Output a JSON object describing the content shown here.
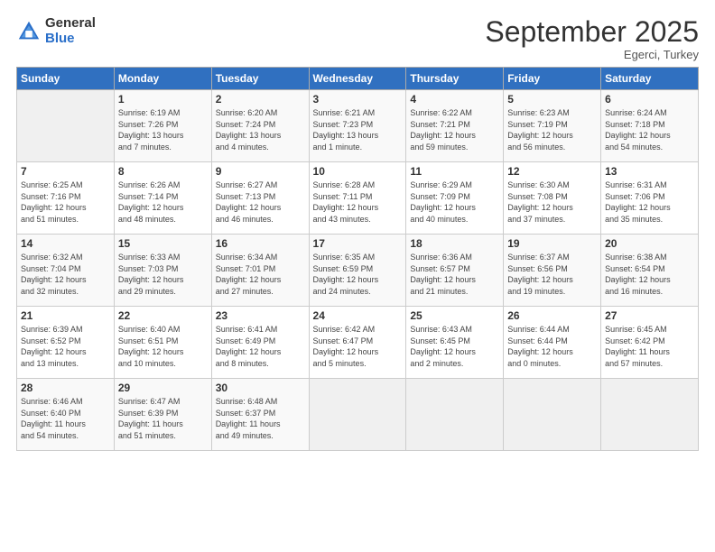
{
  "logo": {
    "general": "General",
    "blue": "Blue"
  },
  "header": {
    "month": "September 2025",
    "location": "Egerci, Turkey"
  },
  "days_of_week": [
    "Sunday",
    "Monday",
    "Tuesday",
    "Wednesday",
    "Thursday",
    "Friday",
    "Saturday"
  ],
  "weeks": [
    [
      {
        "day": "",
        "info": ""
      },
      {
        "day": "1",
        "info": "Sunrise: 6:19 AM\nSunset: 7:26 PM\nDaylight: 13 hours\nand 7 minutes."
      },
      {
        "day": "2",
        "info": "Sunrise: 6:20 AM\nSunset: 7:24 PM\nDaylight: 13 hours\nand 4 minutes."
      },
      {
        "day": "3",
        "info": "Sunrise: 6:21 AM\nSunset: 7:23 PM\nDaylight: 13 hours\nand 1 minute."
      },
      {
        "day": "4",
        "info": "Sunrise: 6:22 AM\nSunset: 7:21 PM\nDaylight: 12 hours\nand 59 minutes."
      },
      {
        "day": "5",
        "info": "Sunrise: 6:23 AM\nSunset: 7:19 PM\nDaylight: 12 hours\nand 56 minutes."
      },
      {
        "day": "6",
        "info": "Sunrise: 6:24 AM\nSunset: 7:18 PM\nDaylight: 12 hours\nand 54 minutes."
      }
    ],
    [
      {
        "day": "7",
        "info": "Sunrise: 6:25 AM\nSunset: 7:16 PM\nDaylight: 12 hours\nand 51 minutes."
      },
      {
        "day": "8",
        "info": "Sunrise: 6:26 AM\nSunset: 7:14 PM\nDaylight: 12 hours\nand 48 minutes."
      },
      {
        "day": "9",
        "info": "Sunrise: 6:27 AM\nSunset: 7:13 PM\nDaylight: 12 hours\nand 46 minutes."
      },
      {
        "day": "10",
        "info": "Sunrise: 6:28 AM\nSunset: 7:11 PM\nDaylight: 12 hours\nand 43 minutes."
      },
      {
        "day": "11",
        "info": "Sunrise: 6:29 AM\nSunset: 7:09 PM\nDaylight: 12 hours\nand 40 minutes."
      },
      {
        "day": "12",
        "info": "Sunrise: 6:30 AM\nSunset: 7:08 PM\nDaylight: 12 hours\nand 37 minutes."
      },
      {
        "day": "13",
        "info": "Sunrise: 6:31 AM\nSunset: 7:06 PM\nDaylight: 12 hours\nand 35 minutes."
      }
    ],
    [
      {
        "day": "14",
        "info": "Sunrise: 6:32 AM\nSunset: 7:04 PM\nDaylight: 12 hours\nand 32 minutes."
      },
      {
        "day": "15",
        "info": "Sunrise: 6:33 AM\nSunset: 7:03 PM\nDaylight: 12 hours\nand 29 minutes."
      },
      {
        "day": "16",
        "info": "Sunrise: 6:34 AM\nSunset: 7:01 PM\nDaylight: 12 hours\nand 27 minutes."
      },
      {
        "day": "17",
        "info": "Sunrise: 6:35 AM\nSunset: 6:59 PM\nDaylight: 12 hours\nand 24 minutes."
      },
      {
        "day": "18",
        "info": "Sunrise: 6:36 AM\nSunset: 6:57 PM\nDaylight: 12 hours\nand 21 minutes."
      },
      {
        "day": "19",
        "info": "Sunrise: 6:37 AM\nSunset: 6:56 PM\nDaylight: 12 hours\nand 19 minutes."
      },
      {
        "day": "20",
        "info": "Sunrise: 6:38 AM\nSunset: 6:54 PM\nDaylight: 12 hours\nand 16 minutes."
      }
    ],
    [
      {
        "day": "21",
        "info": "Sunrise: 6:39 AM\nSunset: 6:52 PM\nDaylight: 12 hours\nand 13 minutes."
      },
      {
        "day": "22",
        "info": "Sunrise: 6:40 AM\nSunset: 6:51 PM\nDaylight: 12 hours\nand 10 minutes."
      },
      {
        "day": "23",
        "info": "Sunrise: 6:41 AM\nSunset: 6:49 PM\nDaylight: 12 hours\nand 8 minutes."
      },
      {
        "day": "24",
        "info": "Sunrise: 6:42 AM\nSunset: 6:47 PM\nDaylight: 12 hours\nand 5 minutes."
      },
      {
        "day": "25",
        "info": "Sunrise: 6:43 AM\nSunset: 6:45 PM\nDaylight: 12 hours\nand 2 minutes."
      },
      {
        "day": "26",
        "info": "Sunrise: 6:44 AM\nSunset: 6:44 PM\nDaylight: 12 hours\nand 0 minutes."
      },
      {
        "day": "27",
        "info": "Sunrise: 6:45 AM\nSunset: 6:42 PM\nDaylight: 11 hours\nand 57 minutes."
      }
    ],
    [
      {
        "day": "28",
        "info": "Sunrise: 6:46 AM\nSunset: 6:40 PM\nDaylight: 11 hours\nand 54 minutes."
      },
      {
        "day": "29",
        "info": "Sunrise: 6:47 AM\nSunset: 6:39 PM\nDaylight: 11 hours\nand 51 minutes."
      },
      {
        "day": "30",
        "info": "Sunrise: 6:48 AM\nSunset: 6:37 PM\nDaylight: 11 hours\nand 49 minutes."
      },
      {
        "day": "",
        "info": ""
      },
      {
        "day": "",
        "info": ""
      },
      {
        "day": "",
        "info": ""
      },
      {
        "day": "",
        "info": ""
      }
    ]
  ]
}
